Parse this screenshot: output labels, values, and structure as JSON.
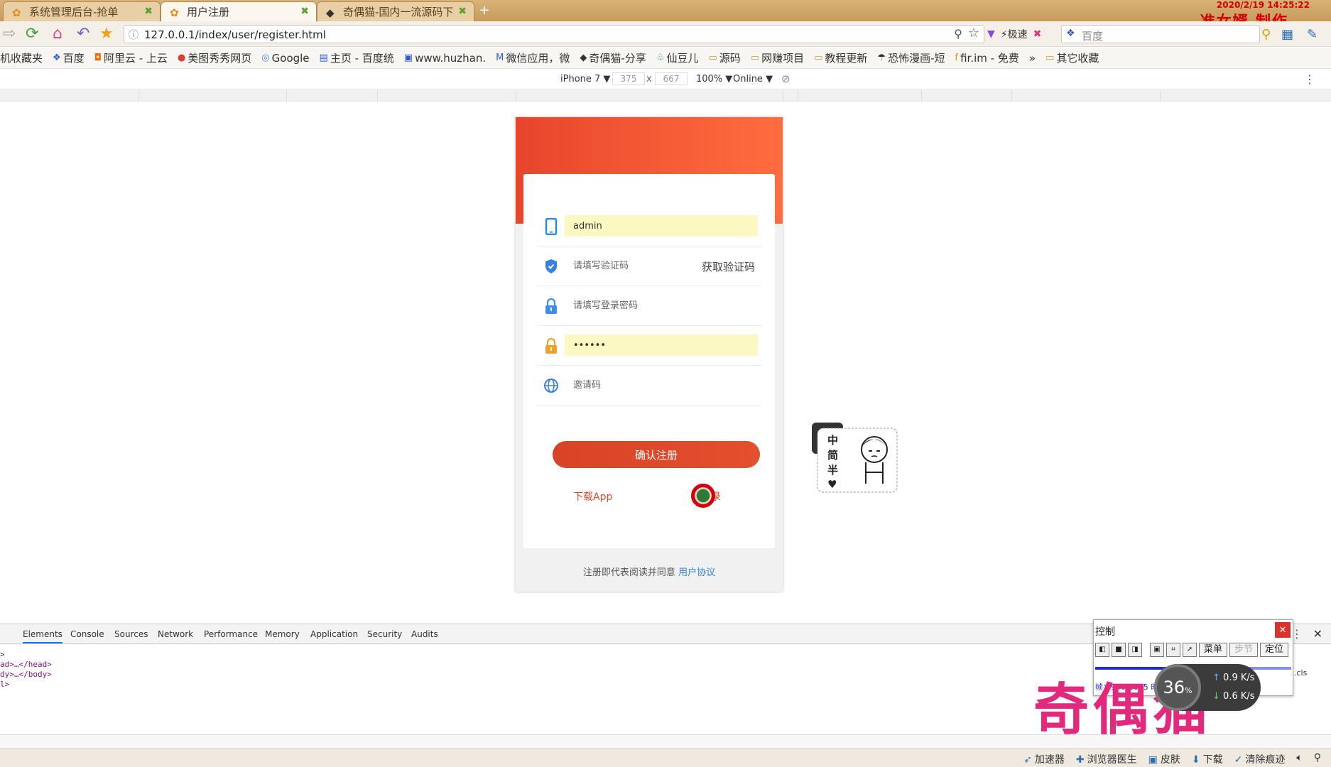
{
  "tabs": [
    {
      "label": "系统管理后台-抢单"
    },
    {
      "label": "用户注册"
    },
    {
      "label": "奇偶猫-国内一流源码下"
    }
  ],
  "brand_text": "准女婿 制作",
  "datestamp": "2020/2/19 14:25:22",
  "address": {
    "url": "127.0.0.1/index/user/register.html"
  },
  "toolbar": {
    "speed_label": "极速",
    "search_placeholder": "百度"
  },
  "bookmarks": [
    "机收藏夹",
    "百度",
    "阿里云 - 上云",
    "美图秀秀网页",
    "Google",
    "主页 - 百度统",
    "www.huzhan.",
    "微信应用，微",
    "奇偶猫-分享",
    "仙豆儿",
    "源码",
    "网赚项目",
    "教程更新",
    "恐怖漫画-短",
    "fir.im - 免费",
    "»",
    "其它收藏"
  ],
  "device": {
    "name": "iPhone 7 ▼",
    "width": "375",
    "height": "667",
    "times": "x",
    "zoom": "100% ▼",
    "network": "Online ▼"
  },
  "form": {
    "phone_value": "admin",
    "code_placeholder": "请填写验证码",
    "get_code_label": "获取验证码",
    "password_placeholder": "请填写登录密码",
    "confirm_value": "••••••",
    "invite_placeholder": "邀请码",
    "submit_label": "确认注册",
    "download_label": "下载App",
    "login_label": "去登录"
  },
  "agreement": {
    "text": "注册即代表阅读并同意",
    "link": "用户协议"
  },
  "sticker": {
    "text": "中\n简\n半"
  },
  "devtools": {
    "tabs": [
      "Elements",
      "Console",
      "Sources",
      "Network",
      "Performance",
      "Memory",
      "Application",
      "Security",
      "Audits"
    ],
    "dom_lines": [
      ">",
      "ad>…</head>",
      "dy>…</body>",
      "l>"
    ],
    "cls_label": ".cls"
  },
  "control_panel": {
    "title": "控制",
    "menu_label": "菜单",
    "step_label": "步节",
    "locate_label": "定位",
    "frames": "帧：940/1605  时间：",
    "progress": 0.59
  },
  "gauge": {
    "percent": "36",
    "percent_sign": "%",
    "up": "0.9 K/s",
    "down": "0.6 K/s"
  },
  "watermark": "奇偶猫",
  "status_items": [
    "加速器",
    "浏览器医生",
    "皮肤",
    "下载",
    "清除痕迹"
  ],
  "colors": {
    "accent": "#e04a2c",
    "link": "#2d7fd6",
    "autofill": "#fbf8c2"
  }
}
